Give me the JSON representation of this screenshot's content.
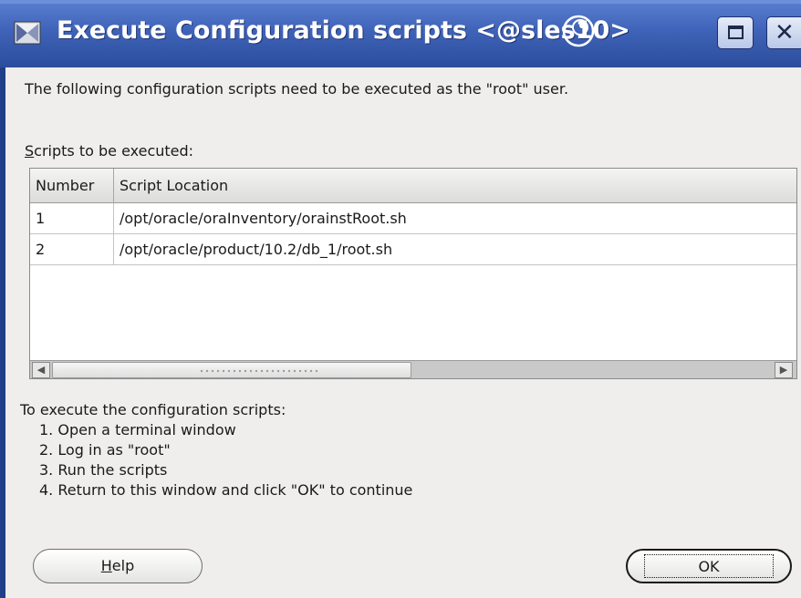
{
  "window": {
    "title": "Execute Configuration scripts  <@sles10>"
  },
  "dialog": {
    "intro": "The following configuration scripts need to be executed as the \"root\" user.",
    "scripts_label_accel": "S",
    "scripts_label_rest": "cripts to be executed:",
    "table": {
      "headers": [
        "Number",
        "Script Location"
      ],
      "rows": [
        {
          "number": "1",
          "location": "/opt/oracle/oraInventory/orainstRoot.sh"
        },
        {
          "number": "2",
          "location": "/opt/oracle/product/10.2/db_1/root.sh"
        }
      ]
    },
    "instructions_heading": "To execute the configuration scripts:",
    "instructions": [
      "1. Open a terminal window",
      "2. Log in as \"root\"",
      "3. Run the scripts",
      "4. Return to this window and click \"OK\" to continue"
    ],
    "help_accel": "H",
    "help_rest": "elp",
    "ok_label": "OK"
  },
  "colors": {
    "titlebar": "#3f63b8",
    "dialog_bg": "#efeeec"
  },
  "icons": {
    "app": "app-icon",
    "title_decoration": "swirl-icon"
  }
}
